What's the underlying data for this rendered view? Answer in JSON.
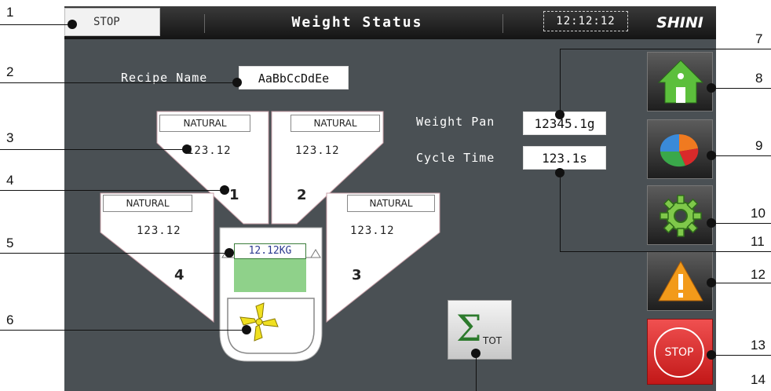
{
  "status": {
    "label": "STOP"
  },
  "header": {
    "title": "Weight Status",
    "clock": "12:12:12",
    "logo": "SHINI"
  },
  "recipe": {
    "label": "Recipe Name",
    "value": "AaBbCcDdEe"
  },
  "weight_pan": {
    "label": "Weight Pan",
    "value": "12345.1g"
  },
  "cycle_time": {
    "label": "Cycle Time",
    "value": "123.1s"
  },
  "hoppers": [
    {
      "material": "NATURAL",
      "value": "123.12",
      "number": "1"
    },
    {
      "material": "NATURAL",
      "value": "123.12",
      "number": "2"
    },
    {
      "material": "NATURAL",
      "value": "123.12",
      "number": "3"
    },
    {
      "material": "NATURAL",
      "value": "123.12",
      "number": "4"
    }
  ],
  "scale": {
    "reading": "12.12KG"
  },
  "buttons": {
    "total_symbol": "Σ",
    "total_sub": "TOT",
    "stop": "STOP"
  },
  "callouts": [
    "1",
    "2",
    "3",
    "4",
    "5",
    "6",
    "7",
    "8",
    "9",
    "10",
    "11",
    "12",
    "13",
    "14"
  ],
  "colors": {
    "panel": "#4a5054",
    "scale_fill": "#8fd18a",
    "stop_red": "#e02a2a",
    "fan_yellow": "#f0e020"
  }
}
